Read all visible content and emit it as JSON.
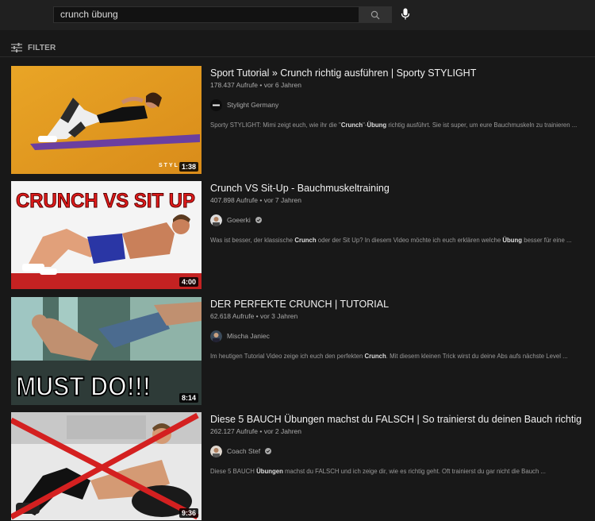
{
  "search": {
    "query": "crunch übung"
  },
  "filter": {
    "label": "FILTER"
  },
  "results": [
    {
      "title": "Sport Tutorial » Crunch richtig ausführen | Sporty STYLIGHT",
      "views": "178.437 Aufrufe",
      "age": "vor 6 Jahren",
      "channel": "Stylight Germany",
      "verified": false,
      "desc_parts": [
        "Sporty STYLIGHT: Mimi zeigt euch, wie ihr die \"",
        "Crunch",
        "\"-",
        "Übung",
        " richtig ausführt. Sie ist super, um eure Bauchmuskeln zu trainieren ..."
      ],
      "duration": "1:38",
      "thumb_text": "STYLIGHT"
    },
    {
      "title": "Crunch VS Sit-Up - Bauchmuskeltraining",
      "views": "407.898 Aufrufe",
      "age": "vor 7 Jahren",
      "channel": "Goeerki",
      "verified": true,
      "desc_parts": [
        "Was ist besser, der klassische ",
        "Crunch",
        " oder der Sit Up? In diesem Video möchte ich euch erklären welche ",
        "Übung",
        " besser für eine ..."
      ],
      "duration": "4:00",
      "thumb_text": "CRUNCH VS SIT UP"
    },
    {
      "title": "DER PERFEKTE CRUNCH | TUTORIAL",
      "views": "62.618 Aufrufe",
      "age": "vor 3 Jahren",
      "channel": "Mischa Janiec",
      "verified": false,
      "desc_parts": [
        "Im heutigen Tutorial Video zeige ich euch den perfekten ",
        "Crunch",
        ". Mit diesem kleinen Trick wirst du deine Abs aufs nächste Level ..."
      ],
      "duration": "8:14",
      "thumb_text": "MUST DO!!!"
    },
    {
      "title": "Diese 5 BAUCH Übungen machst du FALSCH | So trainierst du deinen Bauch richtig",
      "views": "262.127 Aufrufe",
      "age": "vor 2 Jahren",
      "channel": "Coach Stef",
      "verified": true,
      "desc_parts": [
        "Diese 5 BAUCH ",
        "Übungen",
        " machst du FALSCH und ich zeige dir, wie es richtig geht. Oft trainierst du gar nicht die Bauch ..."
      ],
      "duration": "9:36",
      "thumb_text": ""
    }
  ]
}
